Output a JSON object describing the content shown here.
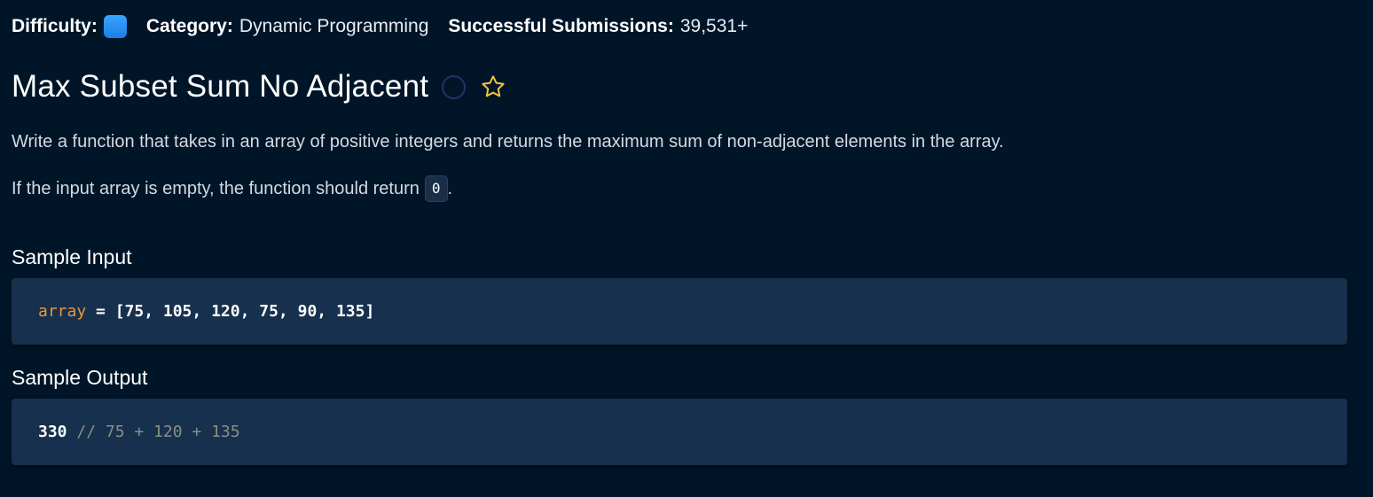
{
  "meta": {
    "difficulty_label": "Difficulty:",
    "difficulty_color": "#2a93f5",
    "category_label": "Category:",
    "category_value": "Dynamic Programming",
    "submissions_label": "Successful Submissions:",
    "submissions_value": "39,531+"
  },
  "title": "Max Subset Sum No Adjacent",
  "icons": {
    "status": "status-circle-icon",
    "favorite": "star-icon"
  },
  "description": {
    "paragraph_1": "Write a function that takes in an array of positive integers and returns the maximum sum of non-adjacent elements in the array.",
    "paragraph_2_prefix": "If the input array is empty, the function should return",
    "paragraph_2_code": "0",
    "paragraph_2_suffix": "."
  },
  "sample_input": {
    "heading": "Sample Input",
    "var_name": "array",
    "assign": " = ",
    "value": "[75, 105, 120, 75, 90, 135]"
  },
  "sample_output": {
    "heading": "Sample Output",
    "value": "330",
    "comment": " // 75 + 120 + 135"
  },
  "colors": {
    "background": "#001528",
    "code_background": "#17304d",
    "variable": "#e69a3a",
    "comment": "#8a8f86",
    "star": "#f5c242"
  }
}
